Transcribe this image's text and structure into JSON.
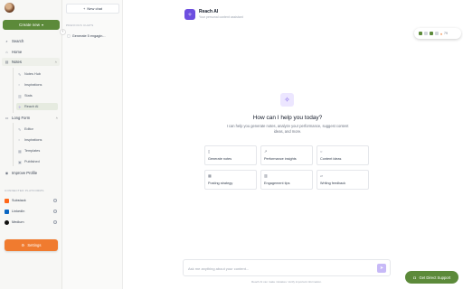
{
  "sidebar": {
    "create_label": "Create new",
    "nav": {
      "search": "Search",
      "home": "Home",
      "notes": "Notes",
      "notes_hub": "Notes Hub",
      "inspirations": "Inspirations",
      "stats": "Stats",
      "reach_ai": "Reach AI",
      "long_form": "Long Form",
      "editor": "Editor",
      "lf_inspirations": "Inspirations",
      "templates": "Templates",
      "published": "Published",
      "improve_profile": "Improve Profile"
    },
    "connected_label": "CONNECTED PLATFORMS",
    "platforms": [
      {
        "name": "Substack",
        "color": "#ff6719"
      },
      {
        "name": "LinkedIn",
        "color": "#0a66c2"
      },
      {
        "name": "Medium",
        "color": "#111111"
      }
    ],
    "settings_label": "Settings"
  },
  "chat_panel": {
    "new_chat_label": "New chat",
    "previous_label": "PREVIOUS CHATS",
    "chats": [
      "Generate 5 engagin..."
    ]
  },
  "header": {
    "title": "Reach AI",
    "subtitle": "Your personal content assistant"
  },
  "status_pill": {
    "value": "79"
  },
  "hero": {
    "title": "How can I help you today?",
    "description": "I can help you generate notes, analyze your performance, suggest content ideas, and more."
  },
  "cards": [
    {
      "label": "Generate notes",
      "icon": "note-icon"
    },
    {
      "label": "Performance insights",
      "icon": "chart-icon"
    },
    {
      "label": "Content ideas",
      "icon": "bulb-icon"
    },
    {
      "label": "Posting strategy",
      "icon": "calendar-icon"
    },
    {
      "label": "Engagement tips",
      "icon": "bar-icon"
    },
    {
      "label": "Writing feedback",
      "icon": "feedback-icon"
    }
  ],
  "input": {
    "placeholder": "Ask me anything about your content..."
  },
  "disclaimer": "Reach AI can make mistakes. Verify important information.",
  "support_label": "Get Direct Support",
  "colors": {
    "brand_green": "#5c8a3a",
    "accent_orange": "#f07b2f",
    "accent_purple": "#6d4fe0"
  }
}
